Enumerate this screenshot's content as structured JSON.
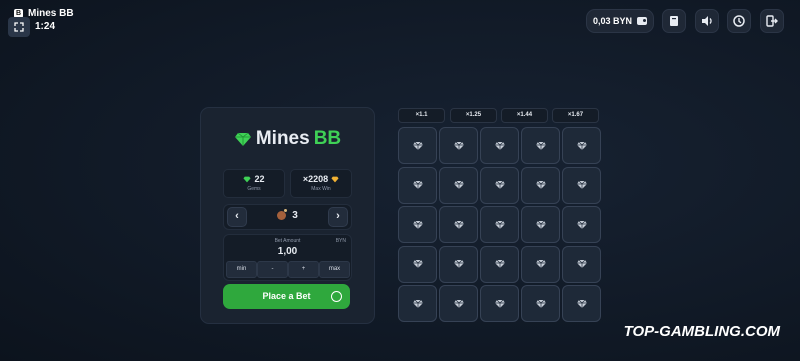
{
  "header": {
    "app_title": "Mines BB",
    "clock": "1:24",
    "balance": "0,03 BYN"
  },
  "logo": {
    "part1": "Mines",
    "part2": "BB"
  },
  "stats": {
    "gems_value": "22",
    "gems_label": "Gems",
    "maxwin_value": "×2208",
    "maxwin_label": "Max Win"
  },
  "mines": {
    "count": "3",
    "prev": "‹",
    "next": "›"
  },
  "bet": {
    "label": "Bet Amount",
    "currency": "BYN",
    "value": "1,00",
    "buttons": [
      "min",
      "-",
      "+",
      "max"
    ]
  },
  "place_bet_label": "Place a Bet",
  "multipliers": [
    "×1.1",
    "×1.25",
    "×1.44",
    "×1.67"
  ],
  "grid": {
    "rows": 5,
    "cols": 5,
    "cell_state": "hidden"
  },
  "watermark": "TOP-GAMBLING.COM",
  "colors": {
    "accent": "#3fd156",
    "button": "#2fa83d",
    "background": "#111a27"
  }
}
